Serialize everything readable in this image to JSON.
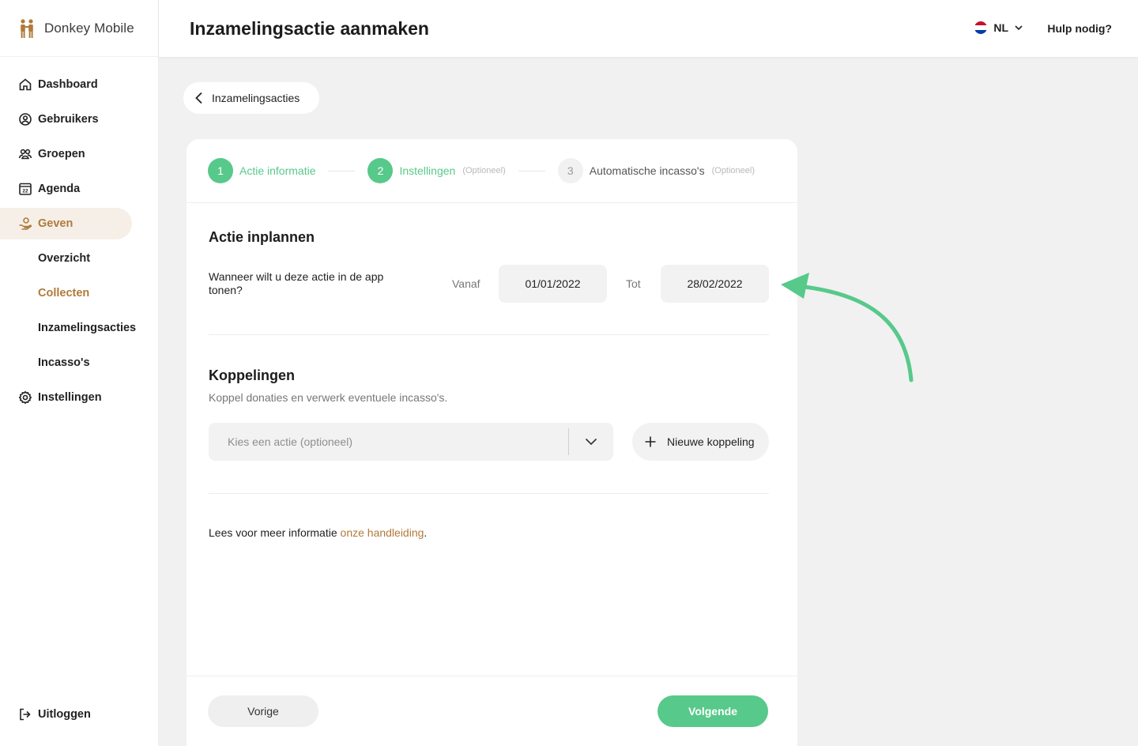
{
  "brand": {
    "name": "Donkey Mobile"
  },
  "sidebar": {
    "items": [
      {
        "label": "Dashboard"
      },
      {
        "label": "Gebruikers"
      },
      {
        "label": "Groepen"
      },
      {
        "label": "Agenda",
        "calendar_day": "22"
      },
      {
        "label": "Geven"
      },
      {
        "label": "Instellingen"
      }
    ],
    "sub_items": [
      {
        "label": "Overzicht"
      },
      {
        "label": "Collecten"
      },
      {
        "label": "Inzamelingsacties"
      },
      {
        "label": "Incasso's"
      }
    ],
    "logout_label": "Uitloggen"
  },
  "header": {
    "title": "Inzamelingsactie aanmaken",
    "language": "NL",
    "help_label": "Hulp nodig?"
  },
  "back": {
    "label": "Inzamelingsacties"
  },
  "stepper": {
    "steps": [
      {
        "num": "1",
        "label": "Actie informatie",
        "optional": ""
      },
      {
        "num": "2",
        "label": "Instellingen",
        "optional": "(Optioneel)"
      },
      {
        "num": "3",
        "label": "Automatische incasso's",
        "optional": "(Optioneel)"
      }
    ]
  },
  "schedule": {
    "title": "Actie inplannen",
    "question": "Wanneer wilt u deze actie in de app tonen?",
    "from_label": "Vanaf",
    "from_value": "01/01/2022",
    "to_label": "Tot",
    "to_value": "28/02/2022"
  },
  "links": {
    "title": "Koppelingen",
    "subtitle": "Koppel donaties en verwerk eventuele incasso's.",
    "select_placeholder": "Kies een actie (optioneel)",
    "new_link_label": "Nieuwe koppeling"
  },
  "info": {
    "prefix": "Lees voor meer informatie ",
    "link": "onze handleiding",
    "suffix": "."
  },
  "footer": {
    "prev_label": "Vorige",
    "next_label": "Volgende"
  },
  "colors": {
    "accent_green": "#57c98a",
    "accent_brown": "#b07a3b",
    "annotation_arrow": "#57c98a"
  }
}
